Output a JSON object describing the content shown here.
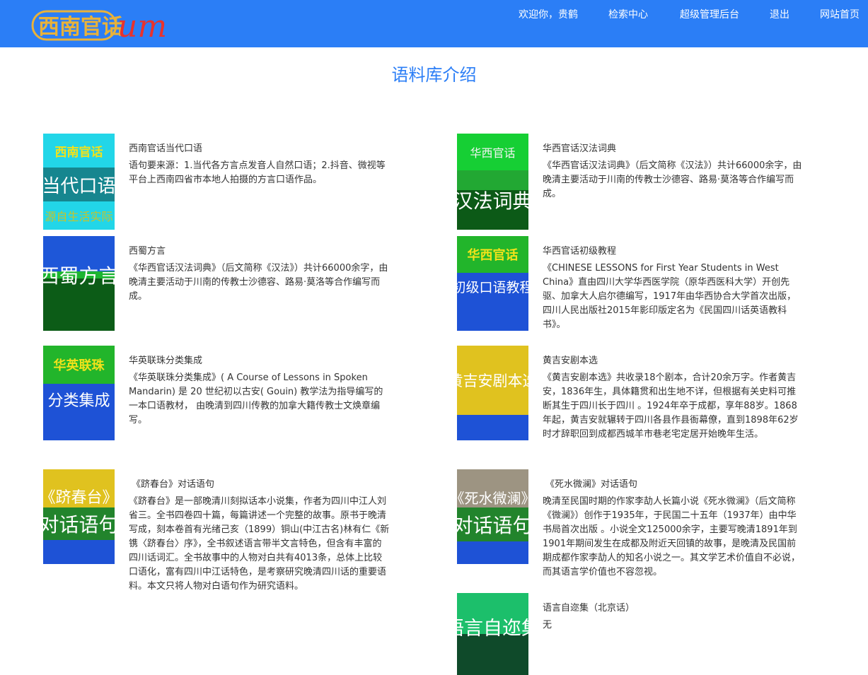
{
  "nav": {
    "logo_text": "西南官话",
    "logo_sub": "UM",
    "welcome": "欢迎你，贵鹤",
    "search": "检索中心",
    "admin": "超级管理后台",
    "logout": "退出",
    "home": "网站首页"
  },
  "page_title": "语料库介绍",
  "cards": [
    {
      "title": "西南官话当代口语",
      "desc": "语句要来源：1.当代各方言点发音人自然口语；2.抖音、微视等平台上西南四省市本地人拍摄的方言口语作品。",
      "thumb": [
        "西南官话",
        "当代口语",
        "源自生活实际"
      ]
    },
    {
      "title": "华西官话汉法词典",
      "desc": "《华西官话汉法词典》（后文简称《汉法》）共计66000余字，由晚清主要活动于川南的传教士沙德容、路易·莫洛等合作编写而成。",
      "thumb": [
        "华西官话",
        "汉法词典"
      ]
    },
    {
      "title": "西蜀方言",
      "desc": "《华西官话汉法词典》（后文简称《汉法》）共计66000余字，由晚清主要活动于川南的传教士沙德容、路易·莫洛等合作编写而成。",
      "thumb": [
        "西蜀方言"
      ]
    },
    {
      "title": "华西官话初级教程",
      "desc": "《CHINESE LESSONS for First Year Students in West China》直由四川大学华西医学院（原华西医科大学）开创先驱、加拿大人启尔德编写，1917年由华西协合大学首次出版，四川人民出版社2015年影印版定名为《民国四川话英语教科书》。",
      "thumb": [
        "华西官话",
        "初级口语教程"
      ]
    },
    {
      "title": "华英联珠分类集成",
      "desc": "《华英联珠分类集成》( A Course of Lessons in Spoken Mandarin) 是 20 世纪初以古安( Gouin) 教学法为指导编写的一本口语教材， 由晚清到四川传教的加拿大籍传教士文焕章编写。",
      "thumb": [
        "华英联珠",
        "分类集成"
      ]
    },
    {
      "title": "黄吉安剧本选",
      "desc": "《黄吉安剧本选》共收录18个剧本，合计20余万字。作者黄吉安，1836年生，具体籍贯和出生地不详，但根据有关史料可推断其生于四川长于四川 。1924年卒于成都，享年88岁。1868年起，黄吉安就辗转于四川各县作县衙幕僚，直到1898年62岁时才辞职回到成都西城羊市巷老宅定居开始晚年生活。",
      "thumb": [
        "黄吉安剧本选"
      ]
    },
    {
      "title": "《跻春台》对话语句",
      "desc": "《跻春台》是一部晚清川刻拟话本小说集，作者为四川中江人刘省三。全书四卷四十篇，每篇讲述一个完整的故事。原书于晚清写成，刻本卷首有光绪己亥（1899）铜山(中江古名)林有仁《新镌〈跻春台〉序》，全书叙述语言带半文言特色，但含有丰富的四川话词汇。全书故事中的人物对白共有4013条，总体上比较口语化，富有四川中江话特色，是考察研究晚清四川话的重要语料。本文只将人物对白语句作为研究语料。",
      "thumb": [
        "《跻春台》",
        "对话语句"
      ]
    },
    {
      "title": "《死水微澜》对话语句",
      "desc": "晚清至民国时期的作家李劼人长篇小说《死水微澜》（后文简称《微澜》）创作于1935年，于民国二十五年（1937年）由中华书局首次出版 。小说全文125000余字，主要写晚清1891年到1901年期间发生在成都及附近天回镇的故事，是晚清及民国前期成都作家李劼人的知名小说之一。其文学艺术价值自不必说，而其语言学价值也不容忽视。",
      "thumb": [
        "《死水微澜》",
        "对话语句"
      ]
    },
    {
      "title": "语言自迩集（北京话）",
      "desc": "无",
      "thumb": [
        "语言自迩集"
      ]
    }
  ]
}
